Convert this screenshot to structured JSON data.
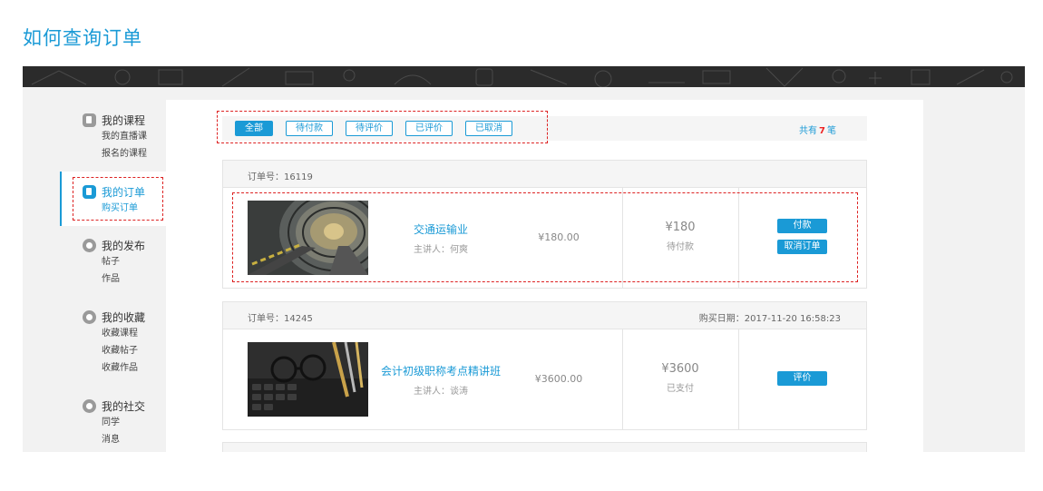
{
  "page_title": "如何查询订单",
  "sidebar": {
    "groups": [
      {
        "label": "我的课程",
        "icon": "course-icon",
        "items": [
          "我的直播课",
          "报名的课程"
        ]
      },
      {
        "label": "我的订单",
        "icon": "order-icon",
        "items": [
          "购买订单"
        ]
      },
      {
        "label": "我的发布",
        "icon": "paper-plane-icon",
        "items": [
          "帖子",
          "作品"
        ]
      },
      {
        "label": "我的收藏",
        "icon": "star-icon",
        "items": [
          "收藏课程",
          "收藏帖子",
          "收藏作品"
        ]
      },
      {
        "label": "我的社交",
        "icon": "chat-icon",
        "items": [
          "同学",
          "消息"
        ]
      }
    ]
  },
  "filters": {
    "tabs": [
      "全部",
      "待付款",
      "待评价",
      "已评价",
      "已取消"
    ],
    "count_prefix": "共有",
    "count": "7",
    "count_suffix": "笔"
  },
  "orders": [
    {
      "order_no": "订单号：16119",
      "date": "",
      "course_name": "交通运输业",
      "lecturer": "主讲人：何爽",
      "price": "¥180.00",
      "amount": "¥180",
      "status": "待付款",
      "actions": [
        "付款",
        "取消订单"
      ]
    },
    {
      "order_no": "订单号：14245",
      "date": "购买日期：2017-11-20 16:58:23",
      "course_name": "会计初级职称考点精讲班",
      "lecturer": "主讲人：谈涛",
      "price": "¥3600.00",
      "amount": "¥3600",
      "status": "已支付",
      "actions": [
        "评价"
      ]
    }
  ],
  "colors": {
    "accent": "#1a9ad6",
    "highlight": "#e22222"
  }
}
